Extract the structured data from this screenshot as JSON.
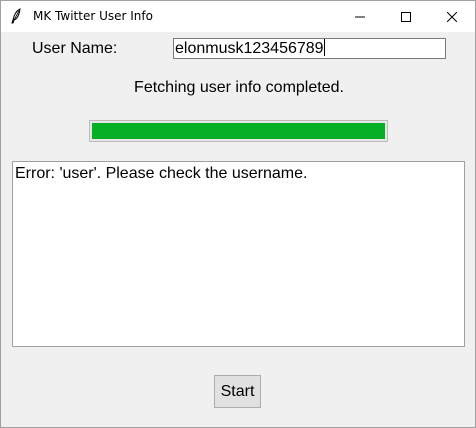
{
  "window": {
    "title": "MK Twitter User Info"
  },
  "form": {
    "username_label": "User Name:",
    "username_value": "elonmusk123456789"
  },
  "status": {
    "text": "Fetching user info completed.",
    "progress_fraction": 1.0,
    "progress_color": "#06b025"
  },
  "output": {
    "text": "Error: 'user'. Please check the username."
  },
  "actions": {
    "start_label": "Start"
  }
}
